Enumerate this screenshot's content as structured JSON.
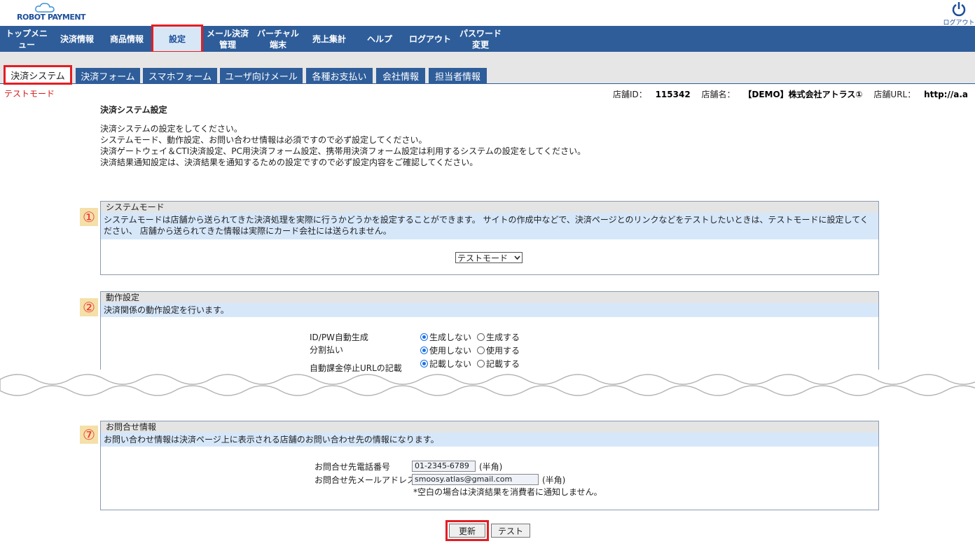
{
  "header": {
    "logo_text": "ROBOT PAYMENT",
    "logout_label": "ログアウト"
  },
  "nav": {
    "items": [
      {
        "label": "トップメニ\nュー"
      },
      {
        "label": "決済情報"
      },
      {
        "label": "商品情報"
      },
      {
        "label": "設定"
      },
      {
        "label": "メール決済\n管理"
      },
      {
        "label": "バーチャル\n端末"
      },
      {
        "label": "売上集計"
      },
      {
        "label": "ヘルプ"
      },
      {
        "label": "ログアウト"
      },
      {
        "label": "パスワード\n変更"
      }
    ]
  },
  "tabs": [
    {
      "label": "決済システム"
    },
    {
      "label": "決済フォーム"
    },
    {
      "label": "スマホフォーム"
    },
    {
      "label": "ユーザ向けメール"
    },
    {
      "label": "各種お支払い"
    },
    {
      "label": "会社情報"
    },
    {
      "label": "担当者情報"
    }
  ],
  "status": {
    "mode_label": "テストモード",
    "shop_id_label": "店舗ID：",
    "shop_id": "115342",
    "shop_name_label": "店舗名：",
    "shop_name": "【DEMO】株式会社アトラス①",
    "shop_url_label": "店舗URL：",
    "shop_url": "http://a.a"
  },
  "page": {
    "title": "決済システム設定",
    "intro": [
      "決済システムの設定をしてください。",
      "システムモード、動作設定、お問い合わせ情報は必須ですので必ず設定してください。",
      "決済ゲートウェイ＆CTI決済設定、PC用決済フォーム設定、携帯用決済フォーム設定は利用するシステムの設定をしてください。",
      "決済結果通知設定は、決済結果を通知するための設定ですので必ず設定内容をご確認してください。"
    ]
  },
  "sections": {
    "system_mode": {
      "badge": "①",
      "title": "システムモード",
      "desc": "システムモードは店舗から送られてきた決済処理を実際に行うかどうかを設定することができます。 サイトの作成中などで、決済ページとのリンクなどをテストしたいときは、テストモードに設定してください、 店舗から送られてきた情報は実際にカード会社には送られません。",
      "select_value": "テストモード"
    },
    "operation": {
      "badge": "②",
      "title": "動作設定",
      "desc": "決済関係の動作設定を行います。",
      "rows": [
        {
          "label": "ID/PW自動生成",
          "opt1": "生成しない",
          "opt2": "生成する"
        },
        {
          "label": "分割払い",
          "opt1": "使用しない",
          "opt2": "使用する"
        },
        {
          "label": "自動課金停止URLの記載",
          "opt1": "記載しない",
          "opt2": "記載する"
        }
      ]
    },
    "contact": {
      "badge": "⑦",
      "title": "お問合せ情報",
      "desc": "お問い合わせ情報は決済ページ上に表示される店舗のお問い合わせ先の情報になります。",
      "phone_label": "お問合せ先電話番号",
      "phone_value": "01-2345-6789",
      "phone_hint": "(半角)",
      "email_label": "お問合せ先メールアドレス",
      "email_value": "smoosy.atlas@gmail.com",
      "email_hint": "(半角)",
      "note": "*空白の場合は決済結果を消費者に通知しません。"
    }
  },
  "actions": {
    "update_label": "更新",
    "test_label": "テスト"
  },
  "colors": {
    "nav_bg": "#2e5d9a",
    "highlight": "#e31e24",
    "desc_bg": "#d6e7fa"
  }
}
